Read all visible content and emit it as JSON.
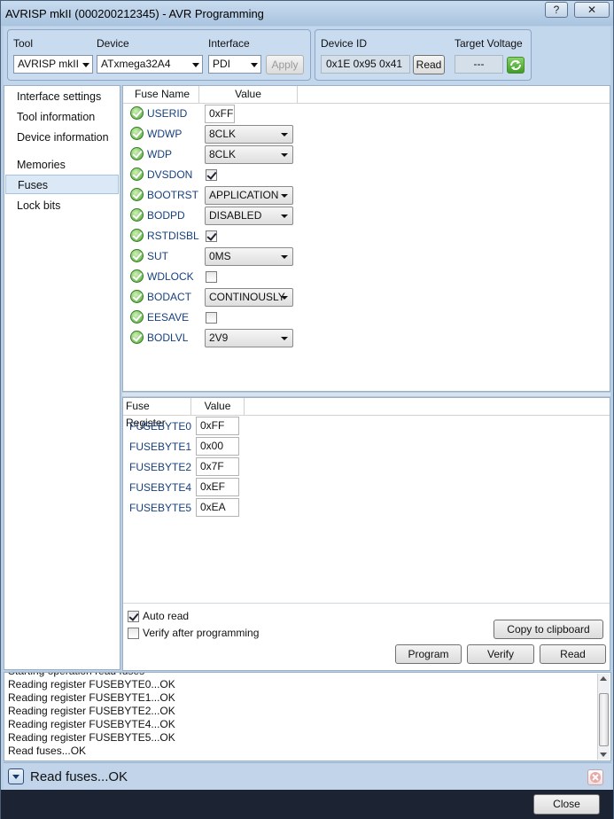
{
  "window": {
    "title": "AVRISP mkII (000200212345) - AVR Programming",
    "help_label": "?",
    "close_label": "✕"
  },
  "toolbar": {
    "tool_label": "Tool",
    "tool_value": "AVRISP mkII",
    "device_label": "Device",
    "device_value": "ATxmega32A4",
    "interface_label": "Interface",
    "interface_value": "PDI",
    "apply_label": "Apply",
    "device_id_label": "Device ID",
    "device_id_value": "0x1E 0x95 0x41",
    "read_label": "Read",
    "target_voltage_label": "Target Voltage",
    "target_voltage_value": "---"
  },
  "nav": {
    "items": [
      {
        "label": "Interface settings"
      },
      {
        "label": "Tool information"
      },
      {
        "label": "Device information"
      },
      {
        "label": "Memories"
      },
      {
        "label": "Fuses"
      },
      {
        "label": "Lock bits"
      }
    ],
    "selected": "Fuses"
  },
  "fuses": {
    "col_name": "Fuse Name",
    "col_value": "Value",
    "rows": [
      {
        "name": "USERID",
        "kind": "text",
        "value": "0xFF"
      },
      {
        "name": "WDWP",
        "kind": "combo",
        "value": "8CLK"
      },
      {
        "name": "WDP",
        "kind": "combo",
        "value": "8CLK"
      },
      {
        "name": "DVSDON",
        "kind": "check",
        "checked": true
      },
      {
        "name": "BOOTRST",
        "kind": "combo",
        "value": "APPLICATION"
      },
      {
        "name": "BODPD",
        "kind": "combo",
        "value": "DISABLED"
      },
      {
        "name": "RSTDISBL",
        "kind": "check",
        "checked": true
      },
      {
        "name": "SUT",
        "kind": "combo",
        "value": "0MS"
      },
      {
        "name": "WDLOCK",
        "kind": "check",
        "checked": false
      },
      {
        "name": "BODACT",
        "kind": "combo",
        "value": "CONTINOUSLY"
      },
      {
        "name": "EESAVE",
        "kind": "check",
        "checked": false
      },
      {
        "name": "BODLVL",
        "kind": "combo",
        "value": "2V9"
      }
    ]
  },
  "registers": {
    "col_name": "Fuse Register",
    "col_value": "Value",
    "rows": [
      {
        "name": "FUSEBYTE0",
        "value": "0xFF"
      },
      {
        "name": "FUSEBYTE1",
        "value": "0x00"
      },
      {
        "name": "FUSEBYTE2",
        "value": "0x7F"
      },
      {
        "name": "FUSEBYTE4",
        "value": "0xEF"
      },
      {
        "name": "FUSEBYTE5",
        "value": "0xEA"
      }
    ]
  },
  "options": {
    "auto_read_label": "Auto read",
    "auto_read": true,
    "verify_label": "Verify after programming",
    "verify": false
  },
  "actions": {
    "copy_label": "Copy to clipboard",
    "program_label": "Program",
    "verify_label": "Verify",
    "read_label": "Read"
  },
  "log": {
    "lines": [
      "Starting operation read fuses",
      "Reading register FUSEBYTE0...OK",
      "Reading register FUSEBYTE1...OK",
      "Reading register FUSEBYTE2...OK",
      "Reading register FUSEBYTE4...OK",
      "Reading register FUSEBYTE5...OK",
      "Read fuses...OK"
    ]
  },
  "status": {
    "text": "Read fuses...OK"
  },
  "footer": {
    "close_label": "Close"
  },
  "icons": {
    "ok": "check-circle-icon",
    "refresh": "refresh-icon",
    "expand": "chevron-down-icon",
    "dismiss": "close-icon"
  }
}
